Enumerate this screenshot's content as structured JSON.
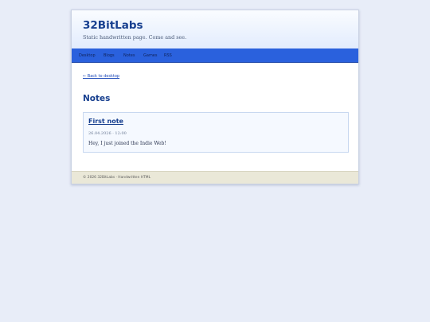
{
  "header": {
    "site_title": "32BitLabs",
    "tagline": "Static handwritten page. Come and see."
  },
  "nav": {
    "items": [
      "Desktop",
      "Blogs",
      "Notes",
      "Games",
      "RSS"
    ]
  },
  "main": {
    "back_link": "← Back to desktop",
    "heading": "Notes",
    "notes": [
      {
        "title": "First note",
        "date": "26.04.2026 · 12:00",
        "body": "Hey, I just joined the Indie Web!"
      }
    ]
  },
  "footer": {
    "text": "© 2026 32BitLabs · Handwritten HTML"
  },
  "colors": {
    "page_background": "#e8edf8",
    "nav_bar": "#2a61dd",
    "accent_text": "#173f8f",
    "footer_background": "#eae8d8"
  }
}
